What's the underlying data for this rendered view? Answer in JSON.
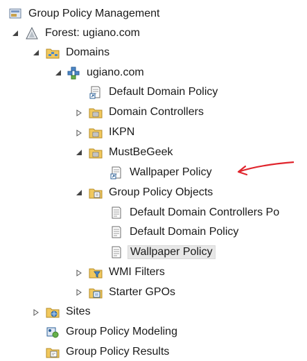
{
  "tree": {
    "root": "Group Policy Management",
    "forest": "Forest: ugiano.com",
    "domains": "Domains",
    "domain": "ugiano.com",
    "default_domain_policy_link": "Default Domain Policy",
    "domain_controllers": "Domain Controllers",
    "ikpn": "IKPN",
    "mustbegeek": "MustBeGeek",
    "wallpaper_policy_link": "Wallpaper Policy",
    "gpo_container": "Group Policy Objects",
    "gpo_ddc": "Default Domain Controllers Po",
    "gpo_ddp": "Default Domain Policy",
    "gpo_wallpaper": "Wallpaper Policy",
    "wmi_filters": "WMI Filters",
    "starter_gpos": "Starter GPOs",
    "sites": "Sites",
    "modeling": "Group Policy Modeling",
    "results": "Group Policy Results"
  },
  "colors": {
    "annotation_arrow": "#e0242c",
    "selection": "#e7e7e7"
  }
}
